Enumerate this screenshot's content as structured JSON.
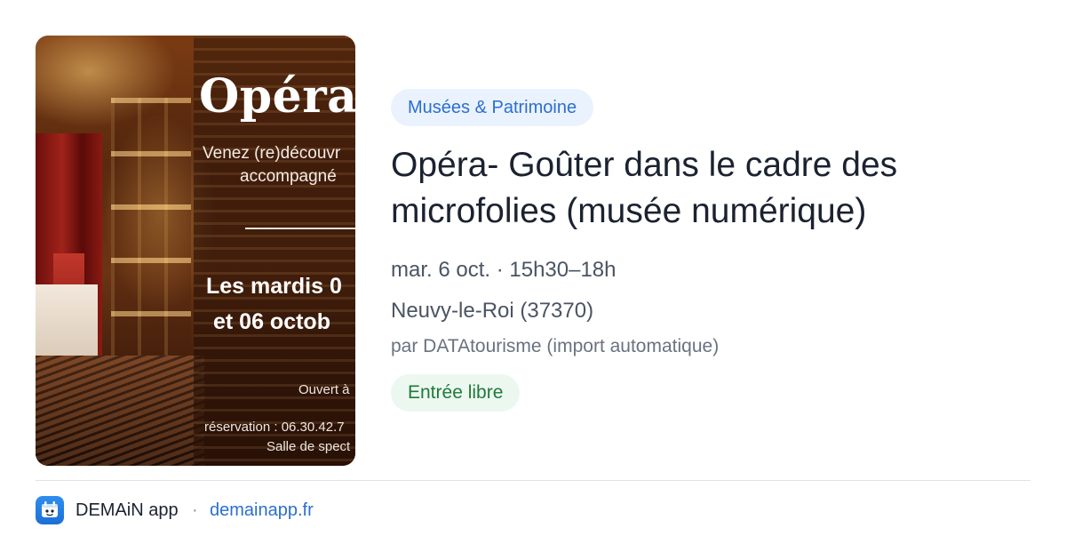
{
  "poster": {
    "title": "Opéra",
    "line1": "Venez (re)découvr",
    "line2": "accompagné",
    "date1": "Les mardis 0",
    "date2": "et 06 octob",
    "ouvert": "Ouvert à",
    "reservation": "réservation : 06.30.42.7",
    "salle": "Salle de spect"
  },
  "event": {
    "category": "Musées & Patrimoine",
    "title": "Opéra- Goûter dans le cadre des microfolies (musée numérique)",
    "datetime": "mar. 6 oct. · 15h30–18h",
    "location": "Neuvy-le-Roi (37370)",
    "author": "par DATAtourisme (import automatique)",
    "price": "Entrée libre"
  },
  "footer": {
    "app_icon": "demain-app-logo-icon",
    "app_name": "DEMAiN app",
    "separator": "·",
    "link": "demainapp.fr"
  },
  "colors": {
    "accent": "#2b6fcf",
    "category_bg": "#eaf2fd",
    "free_bg": "#ecf8ef",
    "free_text": "#1f7a3a"
  }
}
